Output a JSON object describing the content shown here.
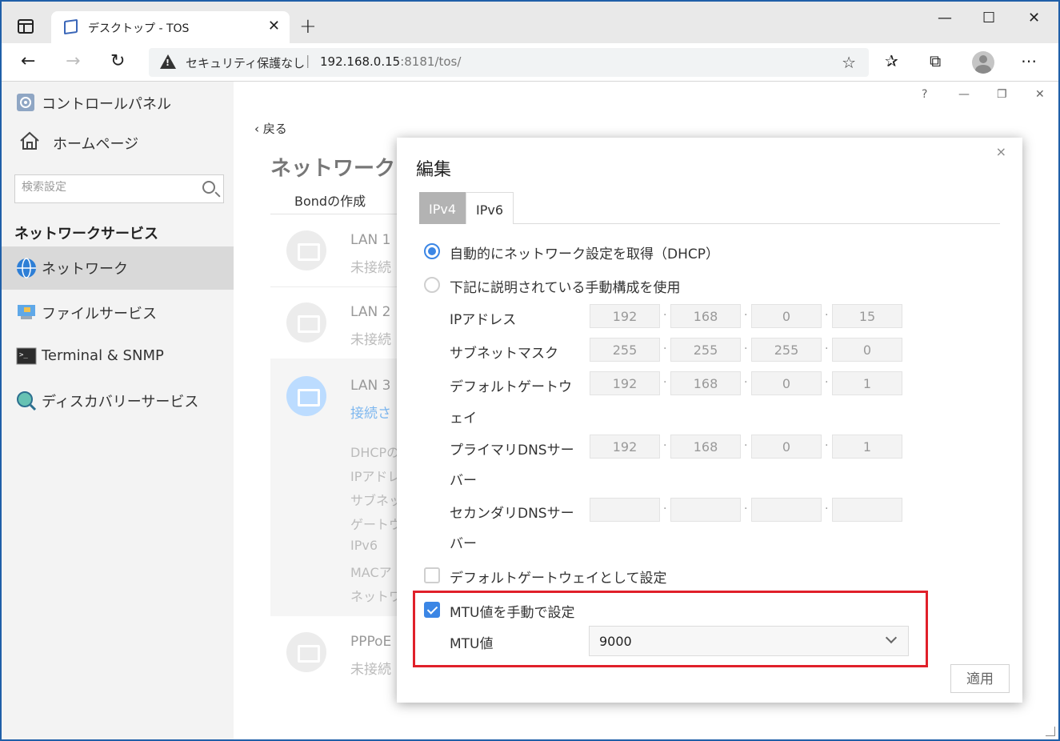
{
  "browser": {
    "tab_title": "デスクトップ - TOS",
    "new_tab_glyph": "+",
    "address": {
      "security_warning": "セキュリティ保護なし",
      "host": "192.168.0.15",
      "path": ":8181/tos/"
    }
  },
  "sidebar": {
    "top_items": [
      {
        "label": "コントロールパネル",
        "icon": "control-panel-icon"
      },
      {
        "label": "ホームページ",
        "icon": "home-icon"
      }
    ],
    "search_placeholder": "検索設定",
    "section_heading": "ネットワークサービス",
    "items": [
      {
        "label": "ネットワーク",
        "icon": "globe-icon",
        "active": true
      },
      {
        "label": "ファイルサービス",
        "icon": "file-service-icon",
        "active": false
      },
      {
        "label": "Terminal & SNMP",
        "icon": "terminal-icon",
        "active": false
      },
      {
        "label": "ディスカバリーサービス",
        "icon": "discovery-icon",
        "active": false
      }
    ]
  },
  "main": {
    "controls": [
      "?",
      "—",
      "❐",
      "✕"
    ],
    "back_label": "戻る",
    "page_title": "ネットワーク",
    "subtab_label": "Bondの作成",
    "lans": [
      {
        "name": "LAN 1",
        "status": "未接続"
      },
      {
        "name": "LAN 2",
        "status": "未接続"
      },
      {
        "name": "LAN 3",
        "status": "接続さ"
      },
      {
        "name": "PPPoE",
        "status": "未接続"
      }
    ],
    "lan3_details": [
      "DHCPの",
      "IPアドレ",
      "サブネッ",
      "ゲートウ",
      "IPv6",
      "MACア",
      "ネットワ"
    ]
  },
  "dialog": {
    "title": "編集",
    "close_glyph": "×",
    "tabs": [
      {
        "label": "IPv4",
        "active": true
      },
      {
        "label": "IPv6",
        "active": false
      }
    ],
    "dhcp_option": "自動的にネットワーク設定を取得（DHCP）",
    "manual_option": "下記に説明されている手動構成を使用",
    "selected_option": "dhcp",
    "fields": [
      {
        "label_line1": "IPアドレス",
        "label_line2": "",
        "octets": [
          "192",
          "168",
          "0",
          "15"
        ]
      },
      {
        "label_line1": "サブネットマスク",
        "label_line2": "",
        "octets": [
          "255",
          "255",
          "255",
          "0"
        ]
      },
      {
        "label_line1": "デフォルトゲートウ",
        "label_line2": "ェイ",
        "octets": [
          "192",
          "168",
          "0",
          "1"
        ]
      },
      {
        "label_line1": "プライマリDNSサー",
        "label_line2": "バー",
        "octets": [
          "192",
          "168",
          "0",
          "1"
        ]
      },
      {
        "label_line1": "セカンダリDNSサー",
        "label_line2": "バー",
        "octets": [
          "",
          "",
          "",
          ""
        ]
      }
    ],
    "default_gateway_checkbox": {
      "label": "デフォルトゲートウェイとして設定",
      "checked": false
    },
    "mtu_checkbox": {
      "label": "MTU値を手動で設定",
      "checked": true
    },
    "mtu_label": "MTU値",
    "mtu_value": "9000",
    "apply_label": "適用"
  },
  "colors": {
    "accent": "#3b86e5",
    "highlight": "#e0202a"
  }
}
